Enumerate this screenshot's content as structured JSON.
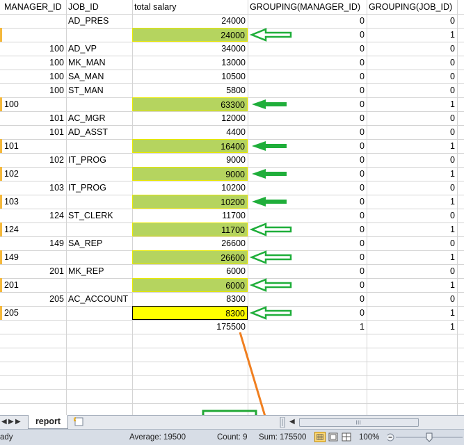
{
  "headers": [
    "MANAGER_ID",
    "JOB_ID",
    "total salary",
    "GROUPING(MANAGER_ID)",
    "GROUPING(JOB_ID)"
  ],
  "rows": [
    {
      "manager_id": "",
      "job_id": "AD_PRES",
      "total_salary": "24000",
      "g_mgr": "0",
      "g_job": "0",
      "highlight": "none",
      "arrow": false
    },
    {
      "manager_id": "",
      "job_id": "",
      "total_salary": "24000",
      "g_mgr": "0",
      "g_job": "1",
      "highlight": "green",
      "arrow": true
    },
    {
      "manager_id": "100",
      "job_id": "AD_VP",
      "total_salary": "34000",
      "g_mgr": "0",
      "g_job": "0",
      "highlight": "none",
      "arrow": false
    },
    {
      "manager_id": "100",
      "job_id": "MK_MAN",
      "total_salary": "13000",
      "g_mgr": "0",
      "g_job": "0",
      "highlight": "none",
      "arrow": false
    },
    {
      "manager_id": "100",
      "job_id": "SA_MAN",
      "total_salary": "10500",
      "g_mgr": "0",
      "g_job": "0",
      "highlight": "none",
      "arrow": false
    },
    {
      "manager_id": "100",
      "job_id": "ST_MAN",
      "total_salary": "5800",
      "g_mgr": "0",
      "g_job": "0",
      "highlight": "none",
      "arrow": false
    },
    {
      "manager_id": "100",
      "job_id": "",
      "total_salary": "63300",
      "g_mgr": "0",
      "g_job": "1",
      "highlight": "green",
      "arrow": true
    },
    {
      "manager_id": "101",
      "job_id": "AC_MGR",
      "total_salary": "12000",
      "g_mgr": "0",
      "g_job": "0",
      "highlight": "none",
      "arrow": false
    },
    {
      "manager_id": "101",
      "job_id": "AD_ASST",
      "total_salary": "4400",
      "g_mgr": "0",
      "g_job": "0",
      "highlight": "none",
      "arrow": false
    },
    {
      "manager_id": "101",
      "job_id": "",
      "total_salary": "16400",
      "g_mgr": "0",
      "g_job": "1",
      "highlight": "green",
      "arrow": true
    },
    {
      "manager_id": "102",
      "job_id": "IT_PROG",
      "total_salary": "9000",
      "g_mgr": "0",
      "g_job": "0",
      "highlight": "none",
      "arrow": false
    },
    {
      "manager_id": "102",
      "job_id": "",
      "total_salary": "9000",
      "g_mgr": "0",
      "g_job": "1",
      "highlight": "green",
      "arrow": true
    },
    {
      "manager_id": "103",
      "job_id": "IT_PROG",
      "total_salary": "10200",
      "g_mgr": "0",
      "g_job": "0",
      "highlight": "none",
      "arrow": false
    },
    {
      "manager_id": "103",
      "job_id": "",
      "total_salary": "10200",
      "g_mgr": "0",
      "g_job": "1",
      "highlight": "green",
      "arrow": true
    },
    {
      "manager_id": "124",
      "job_id": "ST_CLERK",
      "total_salary": "11700",
      "g_mgr": "0",
      "g_job": "0",
      "highlight": "none",
      "arrow": false
    },
    {
      "manager_id": "124",
      "job_id": "",
      "total_salary": "11700",
      "g_mgr": "0",
      "g_job": "1",
      "highlight": "green",
      "arrow": true
    },
    {
      "manager_id": "149",
      "job_id": "SA_REP",
      "total_salary": "26600",
      "g_mgr": "0",
      "g_job": "0",
      "highlight": "none",
      "arrow": false
    },
    {
      "manager_id": "149",
      "job_id": "",
      "total_salary": "26600",
      "g_mgr": "0",
      "g_job": "1",
      "highlight": "green",
      "arrow": true
    },
    {
      "manager_id": "201",
      "job_id": "MK_REP",
      "total_salary": "6000",
      "g_mgr": "0",
      "g_job": "0",
      "highlight": "none",
      "arrow": false
    },
    {
      "manager_id": "201",
      "job_id": "",
      "total_salary": "6000",
      "g_mgr": "0",
      "g_job": "1",
      "highlight": "green",
      "arrow": true
    },
    {
      "manager_id": "205",
      "job_id": "AC_ACCOUNT",
      "total_salary": "8300",
      "g_mgr": "0",
      "g_job": "0",
      "highlight": "none",
      "arrow": false
    },
    {
      "manager_id": "205",
      "job_id": "",
      "total_salary": "8300",
      "g_mgr": "0",
      "g_job": "1",
      "highlight": "yellow",
      "arrow": true
    },
    {
      "manager_id": "",
      "job_id": "",
      "total_salary": "175500",
      "g_mgr": "1",
      "g_job": "1",
      "highlight": "none",
      "arrow": false
    }
  ],
  "sheet_tab": "report",
  "status": {
    "ready": "ady",
    "average": "Average: 19500",
    "count": "Count: 9",
    "sum": "Sum: 175500",
    "zoom": "100%"
  },
  "colors": {
    "highlight_green": "#b5d45f",
    "highlight_yellow": "#ffff00",
    "arrow_green": "#1fae3a",
    "callout_box": "#22a836",
    "callout_line": "#f07f20"
  },
  "icons": {
    "tab_first": "first-sheet-icon",
    "tab_prev": "previous-sheet-icon",
    "tab_next": "next-sheet-icon",
    "tab_last": "last-sheet-icon",
    "insert_sheet": "insert-sheet-icon",
    "view_normal": "normal-view-icon",
    "view_page_layout": "page-layout-view-icon",
    "view_page_break": "page-break-view-icon",
    "zoom_out": "zoom-out-icon",
    "zoom_in": "zoom-in-icon"
  }
}
